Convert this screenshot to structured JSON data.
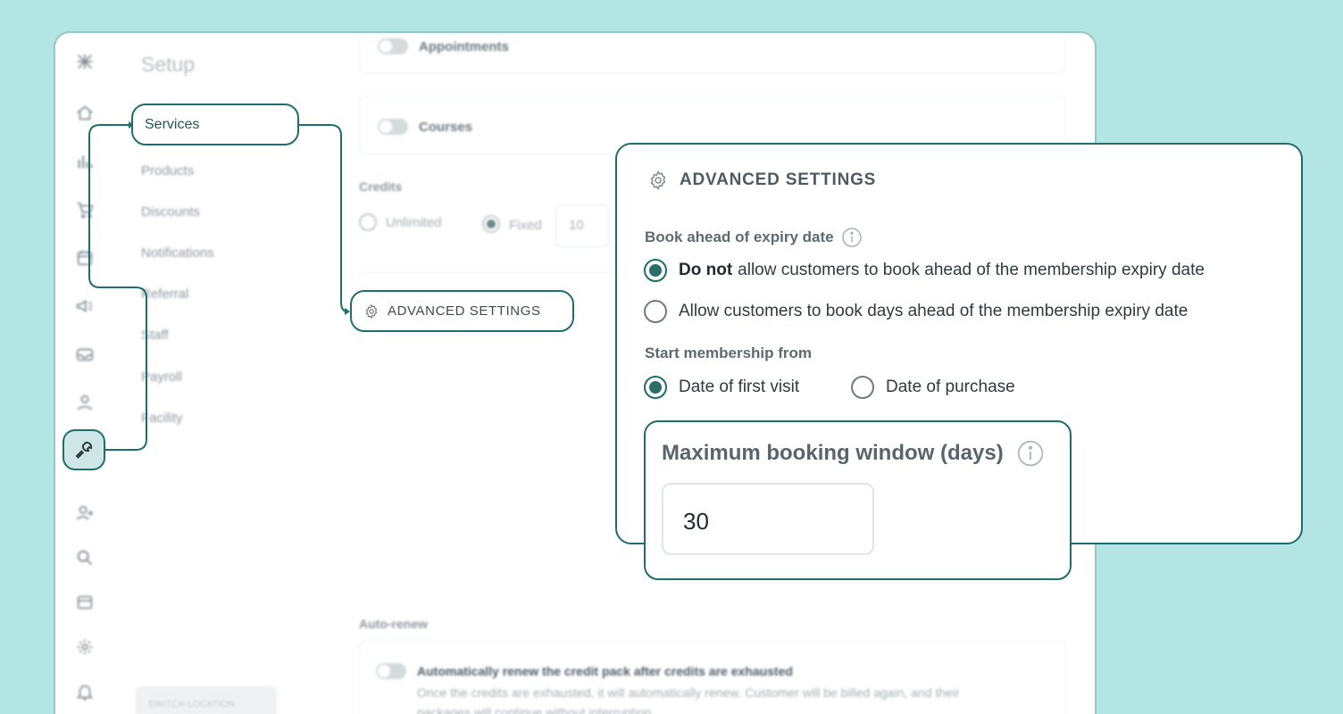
{
  "background_color": "#b2e5e4",
  "accent_color": "#1d6f6d",
  "rail": {
    "icons": [
      "logo-icon",
      "home-icon",
      "reports-icon",
      "cart-icon",
      "calendar-icon",
      "marketing-icon",
      "inbox-icon",
      "user-icon",
      "wrench-icon",
      "add-user-icon",
      "search-icon",
      "store-icon",
      "gear-icon",
      "bell-icon"
    ]
  },
  "setup": {
    "title": "Setup",
    "items": [
      "Services",
      "Products",
      "Discounts",
      "Notifications",
      "Referral",
      "Staff",
      "Payroll",
      "Facility"
    ],
    "switch_location": "SWITCH LOCATION"
  },
  "content": {
    "appointments_label": "Appointments",
    "courses_label": "Courses",
    "credits_label": "Credits",
    "unlimited_label": "Unlimited",
    "fixed_label": "Fixed",
    "fixed_value": "10",
    "advanced_button": "ADVANCED SETTINGS",
    "autorenew_label": "Auto-renew",
    "autorenew_title": "Automatically renew the credit pack after credits are exhausted",
    "autorenew_desc_1": "Once the credits are exhausted, it will automatically renew. Customer will be billed again, and their",
    "autorenew_desc_2": "packages will continue without interruption."
  },
  "advanced_panel": {
    "title": "ADVANCED SETTINGS",
    "book_ahead_label": "Book ahead of expiry date",
    "book_ahead_options": [
      {
        "bold": "Do not",
        "text": "allow customers to book ahead of the membership expiry date",
        "selected": true
      },
      {
        "bold": "",
        "text": "Allow customers to book days ahead of the membership expiry date",
        "selected": false
      }
    ],
    "start_label": "Start membership from",
    "start_options": [
      {
        "text": "Date of first visit",
        "selected": true
      },
      {
        "text": "Date of purchase",
        "selected": false
      }
    ]
  },
  "booking_window": {
    "label": "Maximum booking window (days)",
    "value": "30"
  }
}
